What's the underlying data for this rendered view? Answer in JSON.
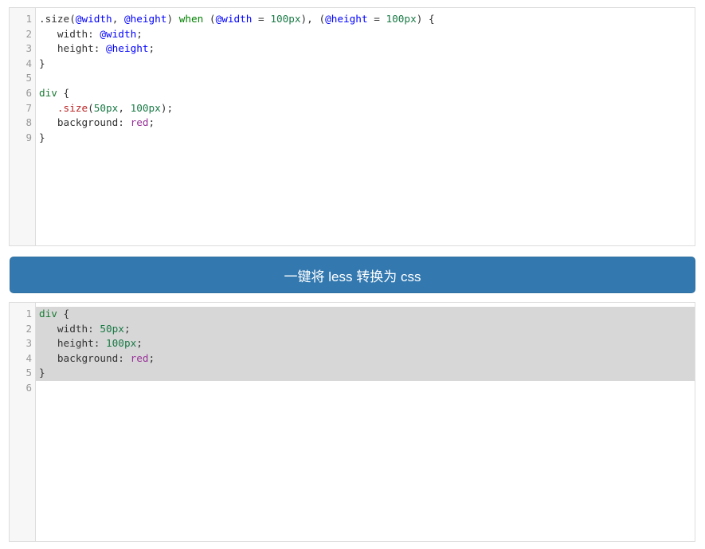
{
  "less_editor": {
    "name": "less-source-editor",
    "line_numbers": [
      "1",
      "2",
      "3",
      "4",
      "5",
      "6",
      "7",
      "8",
      "9"
    ],
    "lines": [
      {
        "n": "1",
        "selected": false,
        "tokens": [
          {
            "t": "plain",
            "s": ".size"
          },
          {
            "t": "punct",
            "s": "("
          },
          {
            "t": "var",
            "s": "@width"
          },
          {
            "t": "punct",
            "s": ", "
          },
          {
            "t": "var",
            "s": "@height"
          },
          {
            "t": "punct",
            "s": ") "
          },
          {
            "t": "kw",
            "s": "when"
          },
          {
            "t": "punct",
            "s": " ("
          },
          {
            "t": "var",
            "s": "@width"
          },
          {
            "t": "punct",
            "s": " = "
          },
          {
            "t": "num",
            "s": "100px"
          },
          {
            "t": "punct",
            "s": "), ("
          },
          {
            "t": "var",
            "s": "@height"
          },
          {
            "t": "punct",
            "s": " = "
          },
          {
            "t": "num",
            "s": "100px"
          },
          {
            "t": "punct",
            "s": ") {"
          }
        ]
      },
      {
        "n": "2",
        "selected": false,
        "tokens": [
          {
            "t": "plain",
            "s": "   width: "
          },
          {
            "t": "var",
            "s": "@width"
          },
          {
            "t": "punct",
            "s": ";"
          }
        ]
      },
      {
        "n": "3",
        "selected": false,
        "tokens": [
          {
            "t": "plain",
            "s": "   height: "
          },
          {
            "t": "var",
            "s": "@height"
          },
          {
            "t": "punct",
            "s": ";"
          }
        ]
      },
      {
        "n": "4",
        "selected": false,
        "tokens": [
          {
            "t": "punct",
            "s": "}"
          }
        ]
      },
      {
        "n": "5",
        "selected": false,
        "tokens": [
          {
            "t": "plain",
            "s": ""
          }
        ]
      },
      {
        "n": "6",
        "selected": false,
        "tokens": [
          {
            "t": "tag",
            "s": "div"
          },
          {
            "t": "punct",
            "s": " {"
          }
        ]
      },
      {
        "n": "7",
        "selected": false,
        "tokens": [
          {
            "t": "plain",
            "s": "   "
          },
          {
            "t": "mixin",
            "s": ".size"
          },
          {
            "t": "punct",
            "s": "("
          },
          {
            "t": "num",
            "s": "50px"
          },
          {
            "t": "punct",
            "s": ", "
          },
          {
            "t": "num",
            "s": "100px"
          },
          {
            "t": "punct",
            "s": ");"
          }
        ]
      },
      {
        "n": "8",
        "selected": false,
        "tokens": [
          {
            "t": "plain",
            "s": "   background: "
          },
          {
            "t": "val",
            "s": "red"
          },
          {
            "t": "punct",
            "s": ";"
          }
        ]
      },
      {
        "n": "9",
        "selected": false,
        "tokens": [
          {
            "t": "punct",
            "s": "}"
          }
        ]
      }
    ],
    "plain_text": ".size(@width, @height) when (@width = 100px), (@height = 100px) {\n   width: @width;\n   height: @height;\n}\n\ndiv {\n   .size(50px, 100px);\n   background: red;\n}"
  },
  "convert_button": {
    "label": "一键将 less 转换为 css",
    "background_color": "#3379b0",
    "text_color": "#ffffff"
  },
  "css_editor": {
    "name": "css-output-editor",
    "line_numbers": [
      "1",
      "2",
      "3",
      "4",
      "5",
      "6"
    ],
    "lines": [
      {
        "n": "1",
        "selected": true,
        "tokens": [
          {
            "t": "tag",
            "s": "div"
          },
          {
            "t": "punct",
            "s": " {"
          }
        ]
      },
      {
        "n": "2",
        "selected": true,
        "tokens": [
          {
            "t": "plain",
            "s": "   width: "
          },
          {
            "t": "num",
            "s": "50px"
          },
          {
            "t": "punct",
            "s": ";"
          }
        ]
      },
      {
        "n": "3",
        "selected": true,
        "tokens": [
          {
            "t": "plain",
            "s": "   height: "
          },
          {
            "t": "num",
            "s": "100px"
          },
          {
            "t": "punct",
            "s": ";"
          }
        ]
      },
      {
        "n": "4",
        "selected": true,
        "tokens": [
          {
            "t": "plain",
            "s": "   background: "
          },
          {
            "t": "val",
            "s": "red"
          },
          {
            "t": "punct",
            "s": ";"
          }
        ]
      },
      {
        "n": "5",
        "selected": true,
        "tokens": [
          {
            "t": "punct",
            "s": "}"
          }
        ]
      },
      {
        "n": "6",
        "selected": false,
        "tokens": [
          {
            "t": "plain",
            "s": ""
          }
        ]
      }
    ],
    "plain_text": "div {\n   width: 50px;\n   height: 100px;\n   background: red;\n}\n"
  },
  "colors": {
    "editor_border": "#dddddd",
    "gutter_background": "#f7f7f7",
    "line_number": "#999999",
    "selection_highlight": "#d7d7d7",
    "variable": "#0000ff",
    "keyword": "#008000",
    "number": "#1a7a46",
    "tag": "#1a7a33",
    "mixin_call": "#bb2222",
    "value": "#993399",
    "plain": "#333333"
  }
}
